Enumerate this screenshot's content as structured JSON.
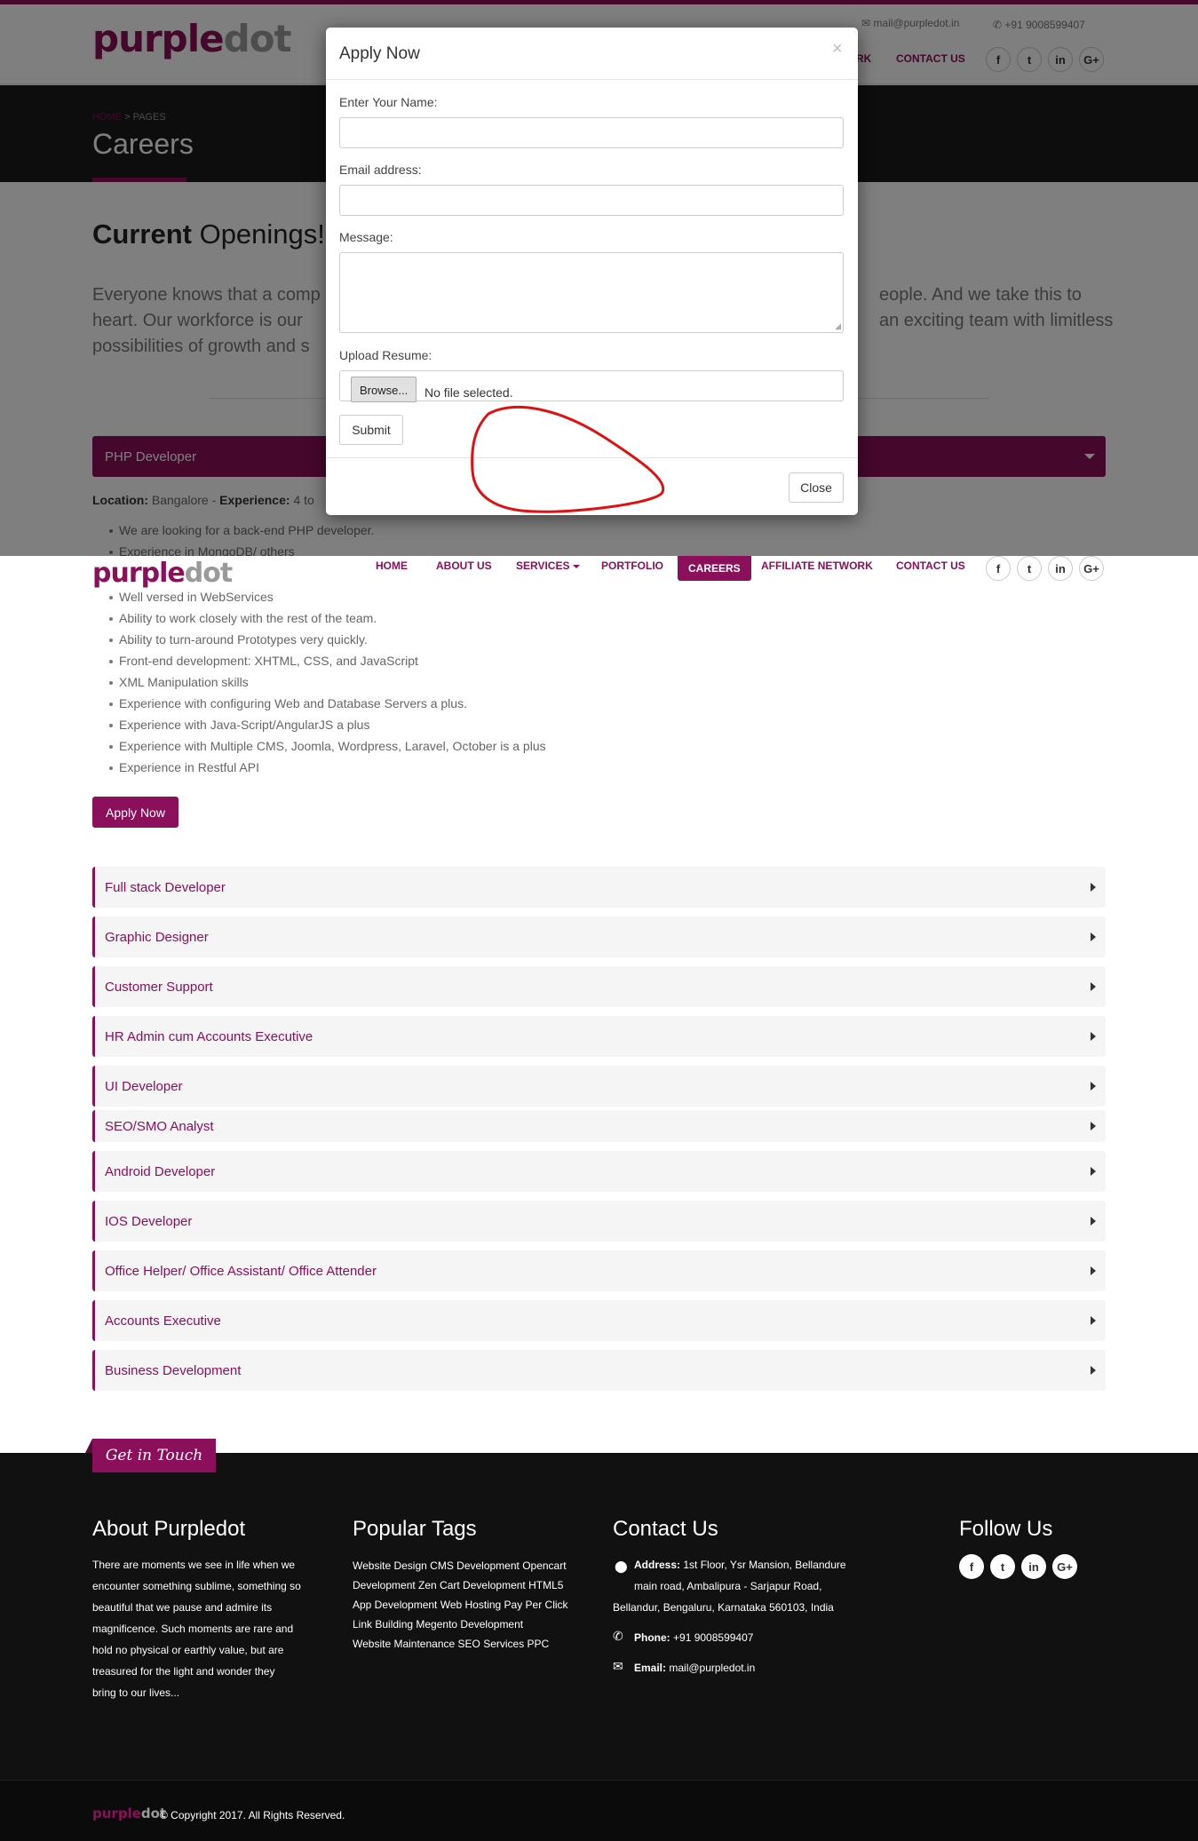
{
  "brand": {
    "logo_part1": "purple",
    "logo_part2": "dot"
  },
  "topbar": {
    "email": "mail@purpledot.in",
    "phone": "+91 9008599407"
  },
  "nav": {
    "items": [
      "HOME",
      "ABOUT US",
      "SERVICES",
      "PORTFOLIO",
      "CAREERS",
      "AFFILIATE NETWORK",
      "CONTACT US"
    ],
    "partial_visible": "RK",
    "active": "CAREERS"
  },
  "social": [
    "f",
    "t",
    "in",
    "G+"
  ],
  "hero": {
    "breadcrumb_home": "HOME",
    "breadcrumb_sep": ">",
    "breadcrumb_current": "PAGES",
    "title": "Careers"
  },
  "intro": {
    "heading_bold": "Current",
    "heading_rest": "Openings!",
    "para_left": [
      "Everyone knows that a comp",
      "heart. Our workforce is our",
      "possibilities of growth and s"
    ],
    "para_right": [
      "eople. And we take this to",
      "an exciting team with limitless"
    ]
  },
  "php_job": {
    "title": "PHP Developer",
    "location_label": "Location:",
    "location_value": "Bangalore",
    "experience_label": "Experience:",
    "experience_value": "4 to",
    "bullets_top": [
      "We are looking for a back-end PHP developer.",
      "Experience in MongoDB/ others"
    ],
    "bullets": [
      "Well versed in WebServices",
      "Ability to work closely with the rest of the team.",
      "Ability to turn-around Prototypes very quickly.",
      "Front-end development: XHTML, CSS, and JavaScript",
      "XML Manipulation skills",
      "Experience with configuring Web and Database Servers a plus.",
      "Experience with Java-Script/AngularJS a plus",
      "Experience with Multiple CMS, Joomla, Wordpress, Laravel, October is a plus",
      "Experience in Restful API"
    ],
    "apply_label": "Apply Now"
  },
  "jobs": [
    "Full stack Developer",
    "Graphic Designer",
    "Customer Support",
    "HR Admin cum Accounts Executive",
    "UI Developer",
    "SEO/SMO Analyst",
    "Android Developer",
    "IOS Developer",
    "Office Helper/ Office Assistant/ Office Attender",
    "Accounts Executive",
    "Business Development"
  ],
  "footer": {
    "get_in_touch": "Get in Touch",
    "about_title": "About Purpledot",
    "about_text": [
      "There are moments we see in life when we",
      "encounter something sublime, something so",
      "beautiful that we pause and admire its",
      "magnificence. Such moments are rare and",
      "hold no physical or earthly value, but are",
      "treasured for the light and wonder they",
      "bring to our lives..."
    ],
    "tags_title": "Popular Tags",
    "tags_text": [
      "Website Design CMS Development Opencart",
      "Development Zen Cart Development HTML5",
      "App Development Web Hosting Pay Per Click",
      "Link Building Megento Development",
      "Website Maintenance SEO Services PPC"
    ],
    "contact_title": "Contact Us",
    "address_label": "Address:",
    "address_lines": [
      "1st Floor, Ysr Mansion, Bellandure",
      "main road, Ambalipura - Sarjapur Road,",
      "Bellandur, Bengaluru, Karnataka 560103, India"
    ],
    "phone_label": "Phone:",
    "phone_value": "+91 9008599407",
    "email_label": "Email:",
    "email_value": "mail@purpledot.in",
    "follow_title": "Follow Us",
    "copyright": "© Copyright 2017. All Rights Reserved."
  },
  "modal": {
    "title": "Apply Now",
    "close_x": "×",
    "name_label": "Enter Your Name:",
    "email_label": "Email address:",
    "message_label": "Message:",
    "resume_label": "Upload Resume:",
    "browse_label": "Browse...",
    "no_file": "No file selected.",
    "submit_label": "Submit",
    "close_label": "Close"
  },
  "colors": {
    "brand": "#8c0f5b",
    "overlay": "rgba(0,0,0,0.5)",
    "annotation": "#e01010",
    "footer": "#111111"
  }
}
